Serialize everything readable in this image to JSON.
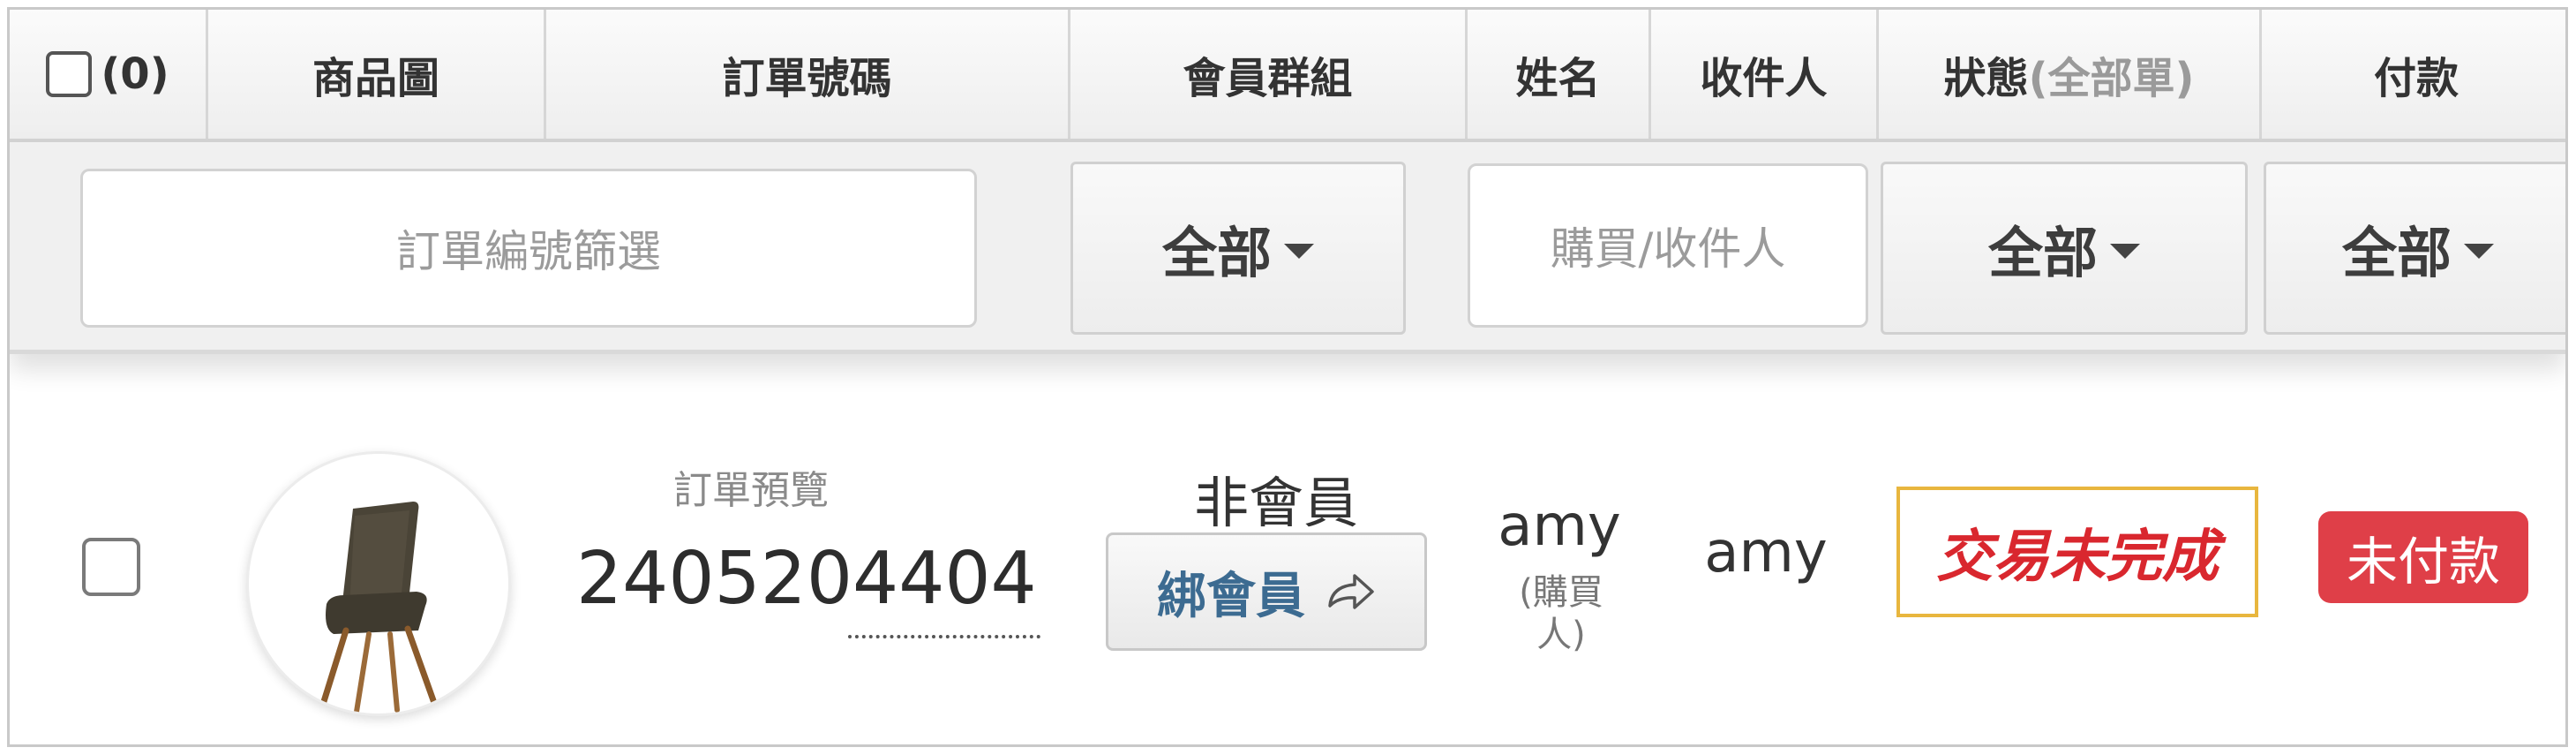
{
  "header": {
    "select_count": "(0)",
    "columns": [
      "商品圖",
      "訂單號碼",
      "會員群組",
      "姓名",
      "收件人",
      "狀態",
      "付款"
    ],
    "status_suffix": "(全部單)"
  },
  "filters": {
    "order_placeholder": "訂單編號篩選",
    "member_group": "全部",
    "buyer_placeholder": "購買/收件人",
    "status": "全部",
    "payment": "全部"
  },
  "order": {
    "preview_label": "訂單預覽",
    "number": "2405204404",
    "member_type": "非會員",
    "bind_label": "綁會員",
    "name": "amy",
    "name_note": "(購買人)",
    "recipient": "amy",
    "status": "交易未完成",
    "payment": "未付款"
  },
  "colors": {
    "status_text": "#d9272e",
    "status_border": "#e8b63e",
    "unpaid_badge": "#df3f48",
    "bind_text": "#3c6b91"
  },
  "icons": {
    "bind": "share-arrow-icon",
    "product": "chair-image"
  }
}
